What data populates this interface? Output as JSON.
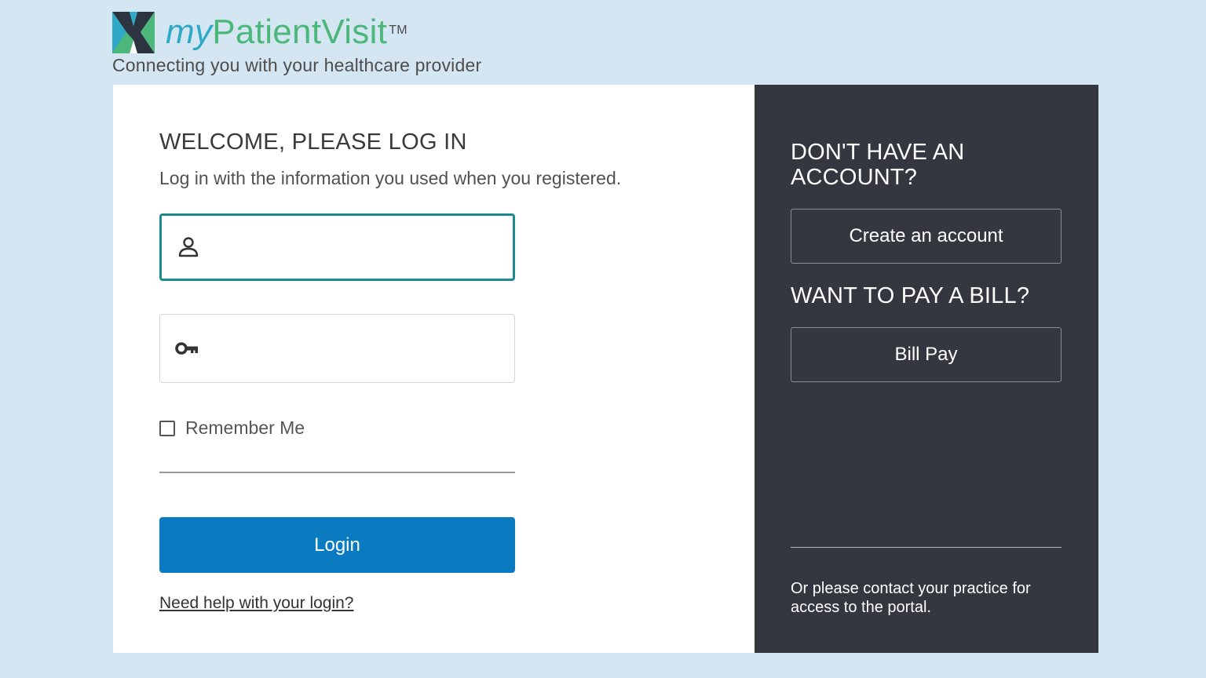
{
  "brand": {
    "name_prefix": "my",
    "name_main": "PatientVisit",
    "trademark": "TM",
    "tagline": "Connecting you with your healthcare provider"
  },
  "login": {
    "heading": "WELCOME, PLEASE LOG IN",
    "instructions": "Log in with the information you used when you registered.",
    "username": {
      "value": "",
      "placeholder": ""
    },
    "password": {
      "value": "",
      "placeholder": ""
    },
    "remember_label": "Remember Me",
    "remember_checked": false,
    "login_button": "Login",
    "help_link": "Need help with your login?"
  },
  "side": {
    "account_heading": "DON'T HAVE AN ACCOUNT?",
    "create_button": "Create an account",
    "bill_heading": "WANT TO PAY A BILL?",
    "bill_button": "Bill Pay",
    "contact_note": "Or please contact your practice for access to the portal."
  },
  "colors": {
    "page_background": "#d5e6f3",
    "login_button": "#0a7bc1",
    "username_focus_border": "#1c8a8e",
    "side_panel": "#343740",
    "brand_green": "#4cb77a",
    "brand_blue": "#2eaac7"
  },
  "icons": {
    "logo": "mypatientvisit-logo-icon",
    "username": "user-icon",
    "password": "key-icon"
  }
}
